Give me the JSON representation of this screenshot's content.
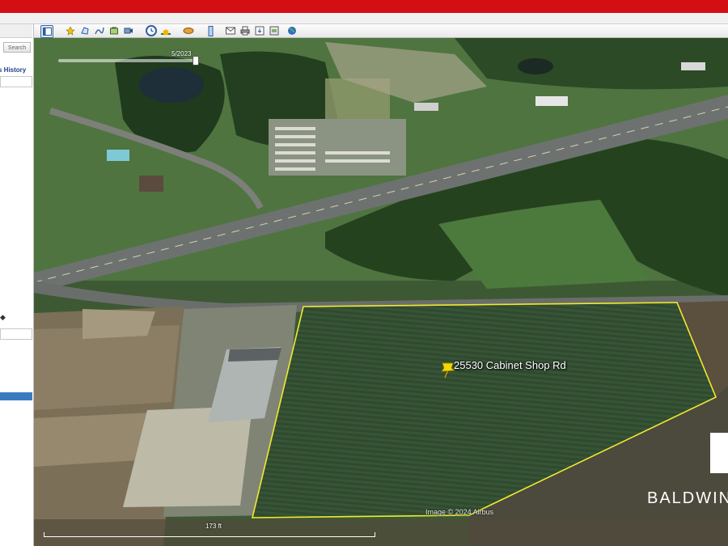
{
  "sidebar": {
    "search_label": "Search",
    "history_label": "s History",
    "scroll_arrow": "◆"
  },
  "toolbar": {
    "buttons": [
      "sidebar-toggle",
      "placemark",
      "polygon",
      "path",
      "image-overlay",
      "record-tour",
      "historical-imagery",
      "sun",
      "planets",
      "ruler",
      "email",
      "print",
      "save-image",
      "view-in-maps",
      "earth-globe"
    ]
  },
  "map": {
    "timeline_date": "5/2023",
    "pin_label": "25530 Cabinet Shop Rd",
    "attribution": "Image © 2024 Airbus",
    "scale_label": "173 ft",
    "brand_text": "BALDWIN"
  },
  "colors": {
    "top_bar": "#d40f14",
    "boundary": "#f2e832",
    "pin": "#f5d800",
    "sidebar_highlight": "#3a7bc0"
  }
}
